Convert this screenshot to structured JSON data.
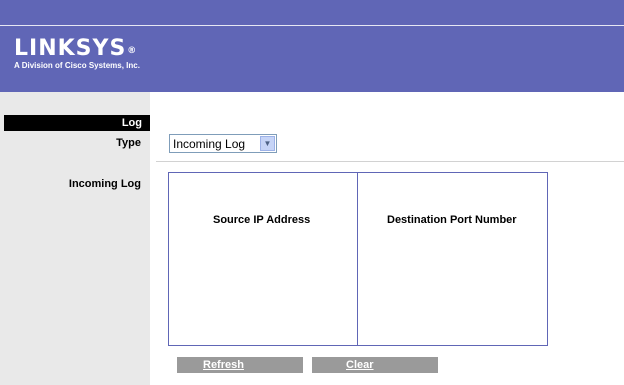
{
  "header": {
    "brand": "LINKSYS",
    "registered": "®",
    "tagline": "A Division of Cisco Systems, Inc."
  },
  "section": {
    "title": "Log"
  },
  "form": {
    "type_label": "Type",
    "type_selected": "Incoming Log",
    "incoming_label": "Incoming Log"
  },
  "table": {
    "columns": [
      "Source IP Address",
      "Destination Port Number"
    ]
  },
  "buttons": {
    "refresh": "Refresh",
    "clear": "Clear"
  },
  "colors": {
    "header_bg": "#6066b6",
    "sidebar_bg": "#e9e9e9",
    "button_bg": "#9a9a9a"
  }
}
